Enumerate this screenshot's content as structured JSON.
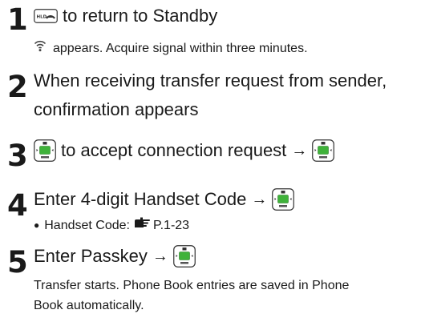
{
  "steps": [
    {
      "number": "1",
      "main_icon": "hld-end-key-icon",
      "main_text": "to return to Standby",
      "sub_icon": "signal-search-icon",
      "sub_text": "appears. Acquire signal within three minutes."
    },
    {
      "number": "2",
      "main_line1": "When receiving transfer request from sender,",
      "main_line2": "confirmation appears"
    },
    {
      "number": "3",
      "main_icon": "center-select-key-icon",
      "main_text": "to accept connection request",
      "arrow": "→",
      "end_icon": "center-select-key-icon"
    },
    {
      "number": "4",
      "main_text": "Enter 4-digit Handset Code",
      "arrow": "→",
      "end_icon": "center-select-key-icon",
      "bullet": "●",
      "sub_label": "Handset Code:",
      "sub_ref_icon": "reference-pointer-icon",
      "sub_ref": "P.1-23"
    },
    {
      "number": "5",
      "main_text": "Enter Passkey",
      "arrow": "→",
      "end_icon": "center-select-key-icon",
      "sub_line1": "Transfer starts. Phone Book entries are saved in Phone",
      "sub_line2": "Book automatically."
    }
  ],
  "colors": {
    "key_green": "#3fb23a",
    "text": "#1a1a1a"
  }
}
